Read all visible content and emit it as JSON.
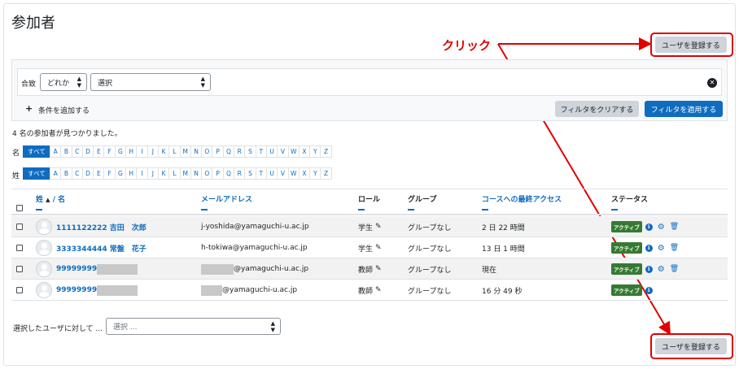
{
  "page": {
    "title": "参加者"
  },
  "enrol_button_label": "ユーザを登録する",
  "annotation": {
    "label": "クリック",
    "color": "#e00000"
  },
  "filter": {
    "match_label": "合致",
    "match_value": "どれか",
    "type_value": "選択",
    "add_condition_label": "条件を追加する",
    "clear_label": "フィルタをクリアする",
    "apply_label": "フィルタを適用する"
  },
  "results_count": "4 名の参加者が見つかりました。",
  "initials": {
    "first_label": "名",
    "last_label": "姓",
    "all_label": "すべて",
    "letters": [
      "A",
      "B",
      "C",
      "D",
      "E",
      "F",
      "G",
      "H",
      "I",
      "J",
      "K",
      "L",
      "M",
      "N",
      "O",
      "P",
      "Q",
      "R",
      "S",
      "T",
      "U",
      "V",
      "W",
      "X",
      "Y",
      "Z"
    ]
  },
  "table": {
    "headers": {
      "lastname": "姓",
      "firstname": "/ 名",
      "email": "メールアドレス",
      "roles": "ロール",
      "groups": "グループ",
      "lastaccess": "コースへの最終アクセス",
      "status": "ステータス"
    },
    "rows": [
      {
        "name": "1111122222 吉田　次郎",
        "email": "j-yoshida@yamaguchi-u.ac.jp",
        "role": "学生",
        "group": "グループなし",
        "access": "2 日 22 時間",
        "status": "アクティブ",
        "actions": [
          "info",
          "settings",
          "delete"
        ]
      },
      {
        "name": "3333344444 常盤　花子",
        "email": "h-tokiwa@yamaguchi-u.ac.jp",
        "role": "学生",
        "group": "グループなし",
        "access": "13 日 1 時間",
        "status": "アクティブ",
        "actions": [
          "info",
          "settings",
          "delete"
        ]
      },
      {
        "name": "99999999",
        "email": "@yamaguchi-u.ac.jp",
        "role": "教師",
        "group": "グループなし",
        "access": "現在",
        "status": "アクティブ",
        "actions": [
          "info",
          "settings",
          "delete"
        ]
      },
      {
        "name": "99999999",
        "email": "@yamaguchi-u.ac.jp",
        "role": "教師",
        "group": "グループなし",
        "access": "16 分 49 秒",
        "status": "アクティブ",
        "actions": [
          "info"
        ]
      }
    ]
  },
  "bulk": {
    "label": "選択したユーザに対して ...",
    "select_value": "選択 ..."
  },
  "colors": {
    "brand": "#0f6cbf",
    "active_badge": "#357a32",
    "annotation": "#e00000"
  }
}
